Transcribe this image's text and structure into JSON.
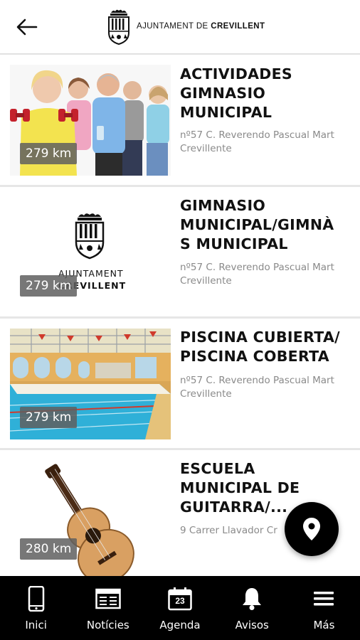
{
  "header": {
    "back_icon": "arrow-left-icon",
    "logo_text_prefix": "AJUNTAMENT DE",
    "logo_text_name": "CREVILLENT"
  },
  "items": [
    {
      "title": "ACTIVIDADES GIMNASIO MUNICIPAL",
      "title_lines": [
        "ACTIVIDADES",
        "GIMNASIO",
        "MUNICIPAL"
      ],
      "address_line1": "nº57 C. Reverendo Pascual Mart",
      "address_line2": "Crevillente",
      "distance": "279 km",
      "image": "seniors-exercising-photo"
    },
    {
      "title": "GIMNASIO MUNICIPAL/GIMNÀS MUNICIPAL",
      "title_lines": [
        "GIMNASIO",
        "MUNICIPAL/GIMNÀ",
        "S MUNICIPAL"
      ],
      "address_line1": "nº57 C. Reverendo Pascual Mart",
      "address_line2": "Crevillente",
      "distance": "279 km",
      "image": "ajuntament-crevillent-logo",
      "logo_line1": "AJUNTAMENT",
      "logo_line2": "CREVILLENT"
    },
    {
      "title": "PISCINA CUBIERTA/PISCINA COBERTA",
      "title_lines": [
        "PISCINA CUBIERTA/",
        "PISCINA COBERTA"
      ],
      "address_line1": "nº57 C. Reverendo Pascual Mart",
      "address_line2": "Crevillente",
      "distance": "279 km",
      "image": "indoor-pool-photo"
    },
    {
      "title": "ESCUELA MUNICIPAL DE GUITARRA/...",
      "title_lines": [
        "ESCUELA",
        "MUNICIPAL DE",
        "GUITARRA/..."
      ],
      "address_line1": "9 Carrer Llavador Cr",
      "address_line2": "",
      "distance": "280 km",
      "image": "guitar-photo"
    }
  ],
  "fab": {
    "icon": "map-pin-icon"
  },
  "nav": [
    {
      "label": "Inici",
      "icon": "phone-icon"
    },
    {
      "label": "Notícies",
      "icon": "newspaper-icon"
    },
    {
      "label": "Agenda",
      "icon": "calendar-icon",
      "calendar_day": "23"
    },
    {
      "label": "Avisos",
      "icon": "bell-icon"
    },
    {
      "label": "Más",
      "icon": "menu-icon"
    }
  ]
}
